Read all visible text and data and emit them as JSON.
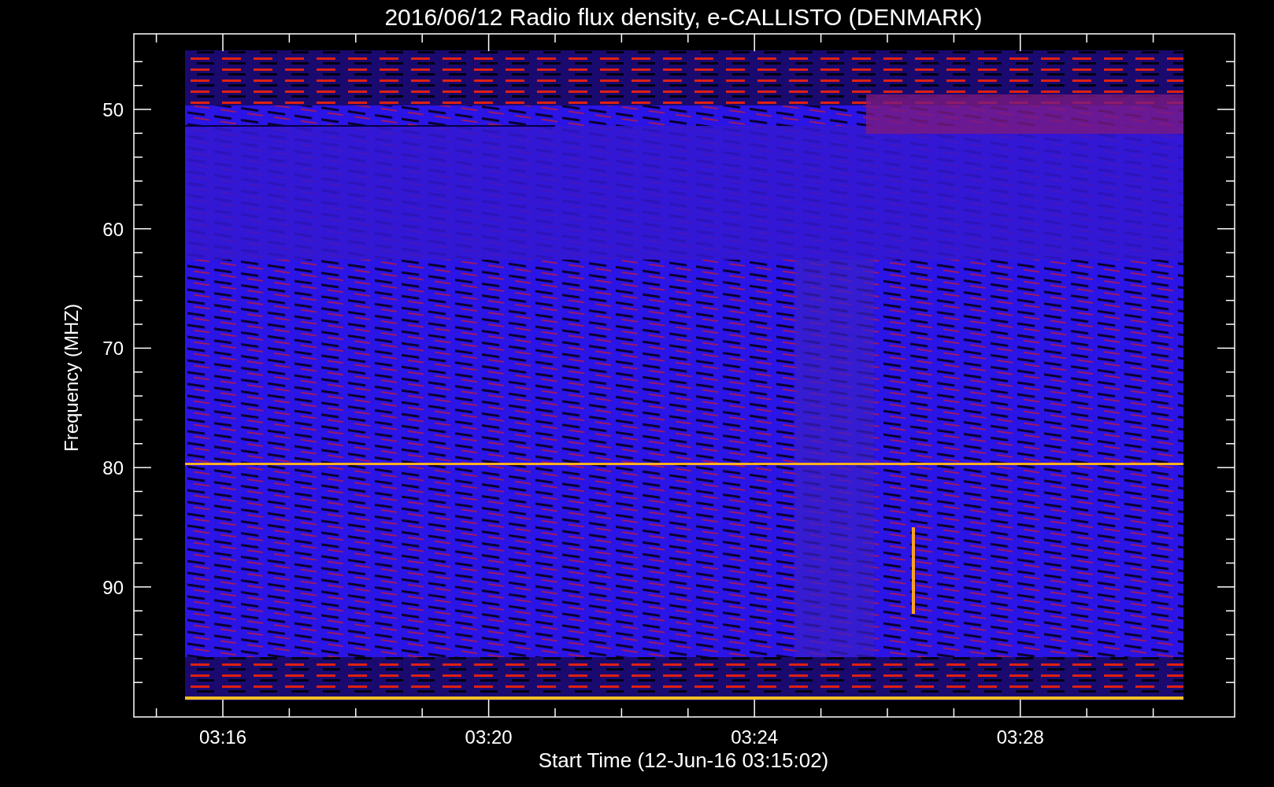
{
  "title": "2016/06/12  Radio flux density, e-CALLISTO (DENMARK)",
  "y_axis": {
    "label": "Frequency (MHZ)",
    "ticks": [
      "50",
      "60",
      "70",
      "80",
      "90"
    ]
  },
  "x_axis": {
    "label": "Start Time (12-Jun-16 03:15:02)",
    "ticks": [
      "03:16",
      "03:20",
      "03:24",
      "03:28"
    ]
  }
}
